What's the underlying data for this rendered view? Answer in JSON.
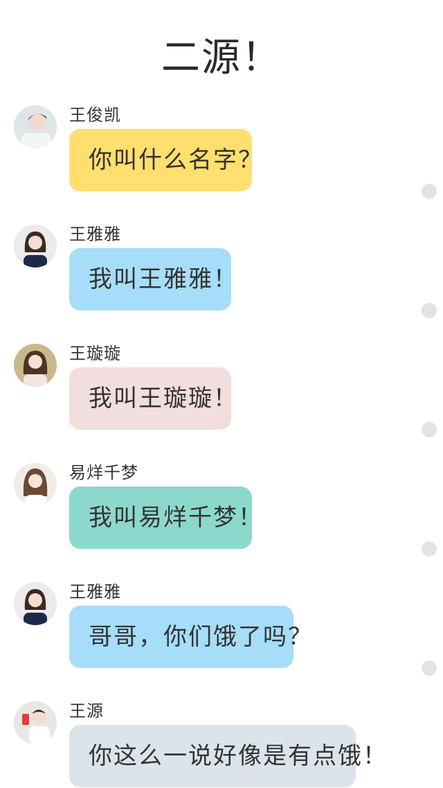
{
  "page_title": "二源！",
  "colors": {
    "yellow": "#ffdf6e",
    "blue": "#a6ddf9",
    "pink": "#f2dedd",
    "teal": "#8dd8cc",
    "gray": "#dce4eb",
    "dot": "#e3e3e3"
  },
  "messages": [
    {
      "sender": "王俊凯",
      "text": "你叫什么名字？",
      "bubble_color": "#ffdf6e",
      "avatar": "boy-avatar-icon"
    },
    {
      "sender": "王雅雅",
      "text": "我叫王雅雅！",
      "bubble_color": "#a6ddf9",
      "avatar": "girl-avatar-icon"
    },
    {
      "sender": "王璇璇",
      "text": "我叫王璇璇！",
      "bubble_color": "#f2dedd",
      "avatar": "girl-avatar-icon"
    },
    {
      "sender": "易烊千梦",
      "text": "我叫易烊千梦！",
      "bubble_color": "#8dd8cc",
      "avatar": "girl-avatar-icon"
    },
    {
      "sender": "王雅雅",
      "text": "哥哥，你们饿了吗？",
      "bubble_color": "#a6ddf9",
      "avatar": "girl-avatar-icon"
    },
    {
      "sender": "王源",
      "text": "你这么一说好像是有点饿！",
      "bubble_color": "#dce4eb",
      "avatar": "boy-avatar-icon"
    }
  ]
}
